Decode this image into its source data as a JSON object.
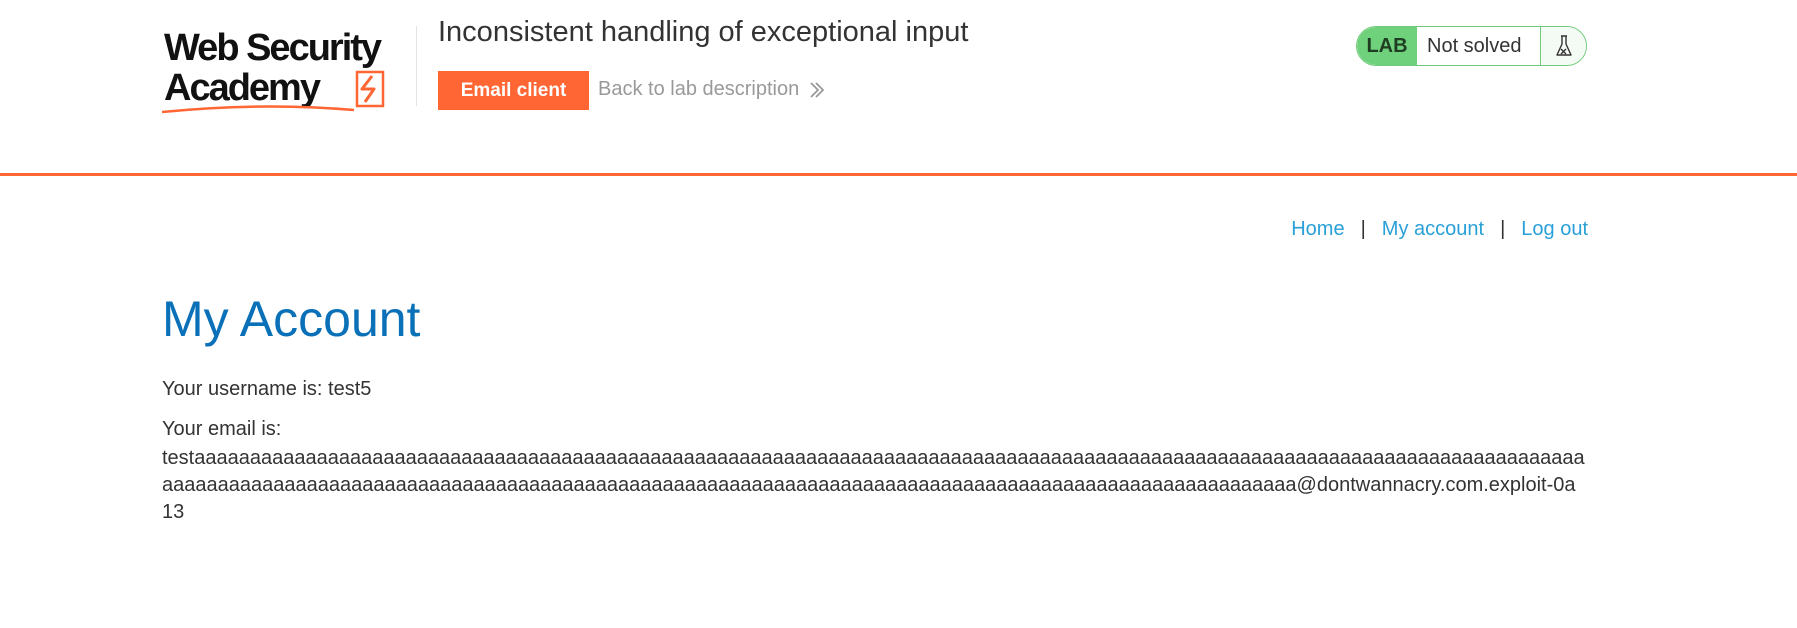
{
  "header": {
    "logo_text_line1": "Web Security",
    "logo_text_line2": "Academy",
    "lab_title": "Inconsistent handling of exceptional input",
    "email_client_label": "Email client",
    "back_link_label": "Back to lab description",
    "status": {
      "badge": "LAB",
      "text": "Not solved",
      "icon": "flask-icon",
      "badge_color": "#70d17c"
    },
    "accent_color": "#ff6633"
  },
  "nav": {
    "home": "Home",
    "my_account": "My account",
    "log_out": "Log out",
    "separator": "|"
  },
  "main": {
    "heading": "My Account",
    "username_label": "Your username is: test5",
    "email_label": "Your email is:",
    "email_value": "testaaaaaaaaaaaaaaaaaaaaaaaaaaaaaaaaaaaaaaaaaaaaaaaaaaaaaaaaaaaaaaaaaaaaaaaaaaaaaaaaaaaaaaaaaaaaaaaaaaaaaaaaaaaaaaaaaaaaaaaaaaaaaaaaaaaaaaaaaaaaaaaaaaaaaaaaaaaaaaaaaaaaaaaaaaaaaaaaaaaaaaaaaaaaaaaaaaaaaaaaaaaaaaaaaaaaaaaaaaaaaaaaaaa@dontwannacry.com.exploit-0a13"
  }
}
